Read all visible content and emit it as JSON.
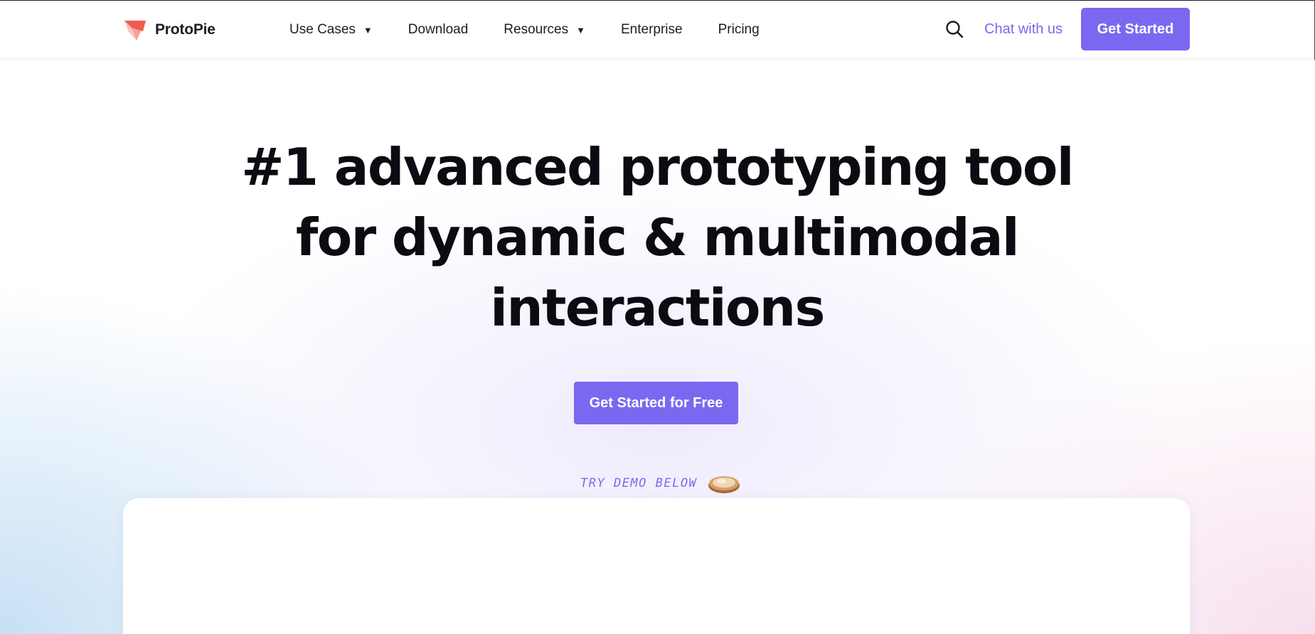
{
  "brand": {
    "name": "ProtoPie",
    "logo_icon": "protopie-logo-icon",
    "accent_color": "#7b68f0",
    "logo_colors": [
      "#f25a4f",
      "#f7a199"
    ]
  },
  "nav": {
    "items": [
      {
        "label": "Use Cases",
        "has_dropdown": true
      },
      {
        "label": "Download",
        "has_dropdown": false
      },
      {
        "label": "Resources",
        "has_dropdown": true
      },
      {
        "label": "Enterprise",
        "has_dropdown": false
      },
      {
        "label": "Pricing",
        "has_dropdown": false
      }
    ],
    "dropdown_icon": "▼"
  },
  "header_actions": {
    "search_icon": "search-icon",
    "chat_label": "Chat with us",
    "cta_label": "Get Started"
  },
  "hero": {
    "title_lines": [
      "#1 advanced prototyping tool",
      "for dynamic & multimodal",
      "interactions"
    ],
    "cta_label": "Get Started for Free",
    "demo_hint": "TRY DEMO BELOW",
    "demo_icon": "pie-icon"
  }
}
